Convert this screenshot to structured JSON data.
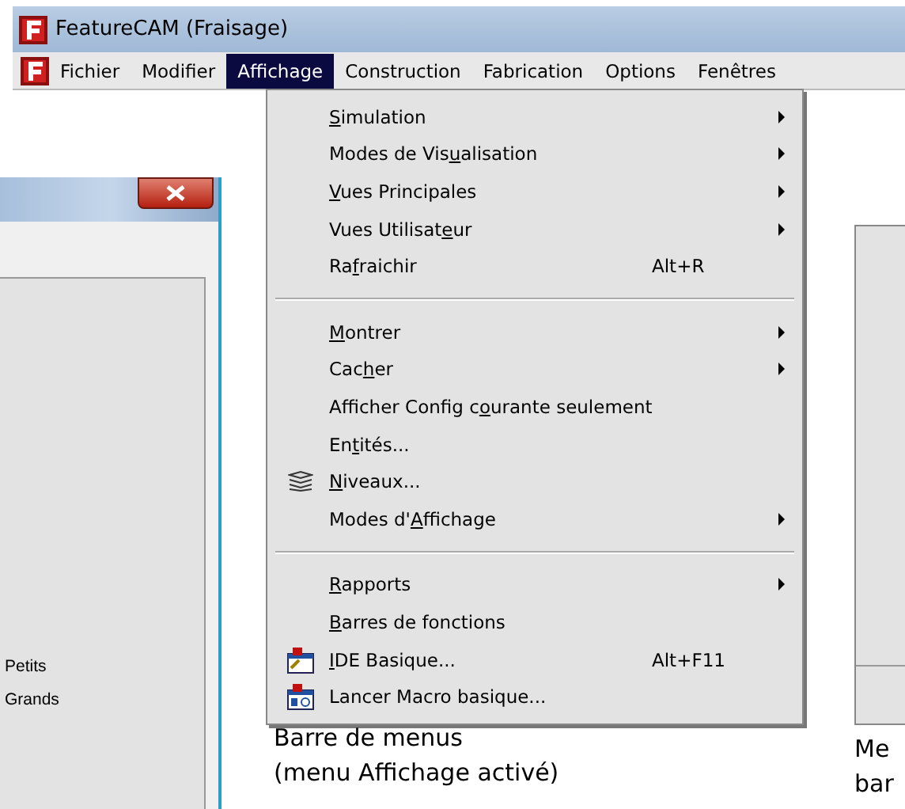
{
  "window": {
    "title": "FeatureCAM (Fraisage)"
  },
  "menubar": [
    {
      "label": "Fichier",
      "selected": false
    },
    {
      "label": "Modifier",
      "selected": false
    },
    {
      "label": "Affichage",
      "selected": true
    },
    {
      "label": "Construction",
      "selected": false
    },
    {
      "label": "Fabrication",
      "selected": false
    },
    {
      "label": "Options",
      "selected": false
    },
    {
      "label": "Fenêtres",
      "selected": false
    }
  ],
  "menu": [
    {
      "kind": "plain",
      "key": "S",
      "after": "imulation",
      "submenu": true
    },
    {
      "kind": "plain",
      "before": "Modes de Vis",
      "key": "u",
      "after": "alisation",
      "submenu": true
    },
    {
      "kind": "plain",
      "key": "V",
      "after": "ues Principales",
      "submenu": true
    },
    {
      "kind": "plain",
      "before": "Vues Utilisat",
      "key": "e",
      "after": "ur",
      "submenu": true
    },
    {
      "kind": "plain",
      "before": "Ra",
      "key": "f",
      "after": "raichir",
      "submenu": false,
      "shortcut": "Alt+R"
    },
    {
      "kind": "separator"
    },
    {
      "kind": "plain",
      "key": "M",
      "after": "ontrer",
      "submenu": true
    },
    {
      "kind": "plain",
      "before": "Cac",
      "key": "h",
      "after": "er",
      "submenu": true
    },
    {
      "kind": "plain",
      "before": "Afficher Config c",
      "key": "o",
      "after": "urante seulement",
      "submenu": false
    },
    {
      "kind": "plain",
      "before": "En",
      "key": "t",
      "after": "ités...",
      "submenu": false
    },
    {
      "kind": "layers",
      "key": "N",
      "after": "iveaux...",
      "submenu": false
    },
    {
      "kind": "plain",
      "before": "Modes d'",
      "key": "A",
      "after": "ffichage",
      "submenu": true
    },
    {
      "kind": "separator"
    },
    {
      "kind": "plain",
      "key": "R",
      "after": "apports",
      "submenu": true
    },
    {
      "kind": "plain",
      "key": "B",
      "after": "arres de fonctions",
      "submenu": false
    },
    {
      "kind": "macro_editor",
      "key": "I",
      "after": "DE Basique...",
      "submenu": false,
      "shortcut": "Alt+F11"
    },
    {
      "kind": "macro_run",
      "before": "Lancer Macro basique...",
      "submenu": false
    }
  ],
  "caption": [
    "Barre de menus",
    "(menu Affichage activé)"
  ],
  "dialog": {
    "labels": [
      "Petits",
      "Grands"
    ]
  },
  "right_caption": [
    "Me",
    "bar"
  ]
}
